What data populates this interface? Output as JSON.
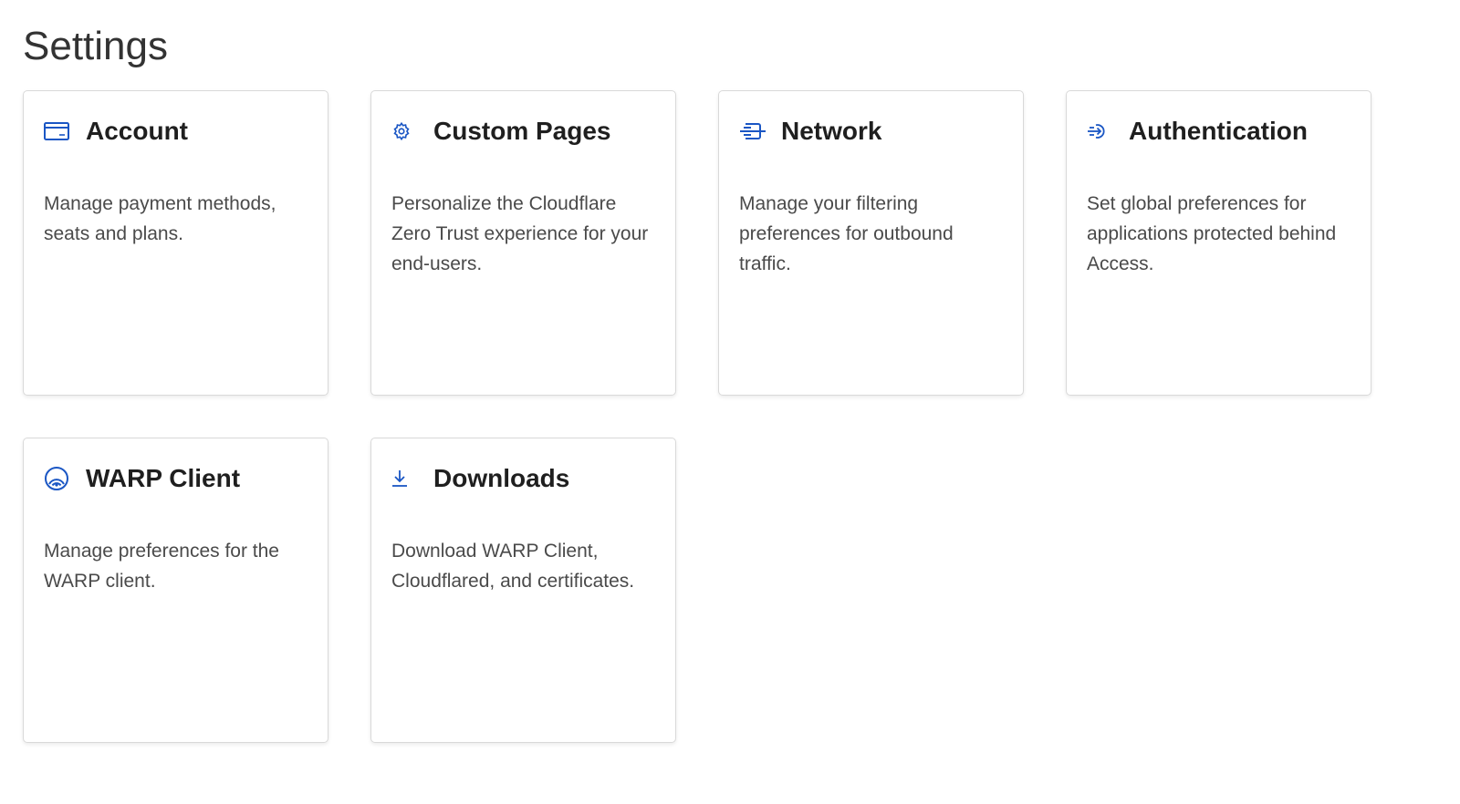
{
  "page": {
    "title": "Settings"
  },
  "theme": {
    "icon_color": "#1a56c4",
    "card_border": "#d9d9d9"
  },
  "cards": [
    {
      "icon": "credit-card-icon",
      "title": "Account",
      "description": "Manage payment methods, seats and plans."
    },
    {
      "icon": "gear-icon",
      "title": "Custom Pages",
      "description": "Personalize the Cloudflare Zero Trust experience for your end-users."
    },
    {
      "icon": "network-icon",
      "title": "Network",
      "description": "Manage your filtering preferences for outbound traffic."
    },
    {
      "icon": "sign-in-icon",
      "title": "Authentication",
      "description": "Set global preferences for applications protected behind Access."
    },
    {
      "icon": "warp-icon",
      "title": "WARP Client",
      "description": "Manage preferences for the WARP client."
    },
    {
      "icon": "download-icon",
      "title": "Downloads",
      "description": "Download WARP Client, Cloudflared, and certificates."
    }
  ]
}
